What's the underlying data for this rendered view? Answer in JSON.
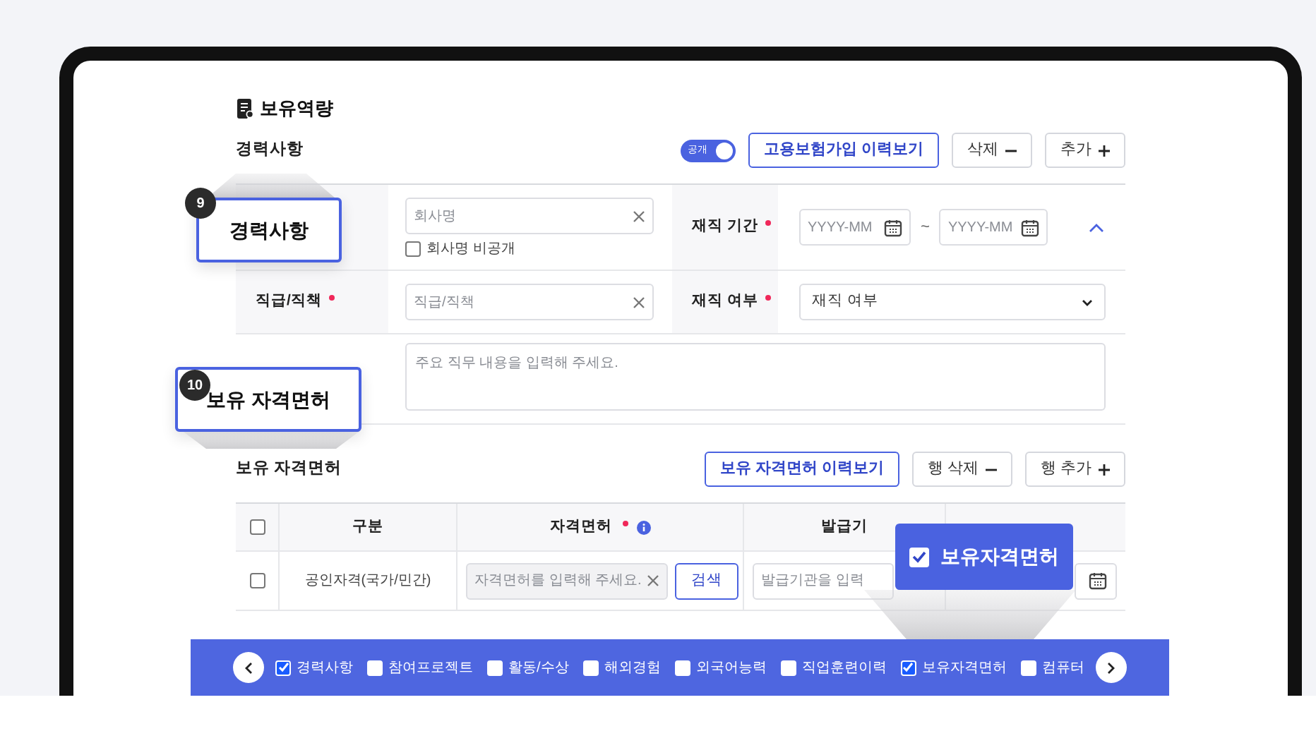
{
  "page_title": "보유역량",
  "career": {
    "title": "경력사항",
    "visibility_toggle": {
      "label": "공개",
      "on": true
    },
    "buttons": [
      {
        "label": "고용보험가입 이력보기",
        "kind": "outline"
      },
      {
        "label": "삭제",
        "kind": "minus"
      },
      {
        "label": "추가",
        "kind": "plus"
      }
    ],
    "company_field": {
      "placeholder": "회사명"
    },
    "hide_company": {
      "label": "회사명 비공개",
      "checked": false
    },
    "period": {
      "label": "재직 기간",
      "required": true,
      "start_placeholder": "YYYY-MM",
      "separator": "~",
      "end_placeholder": "YYYY-MM"
    },
    "expanded": true,
    "position": {
      "label": "직급/직책",
      "required": true,
      "placeholder": "직급/직책"
    },
    "status": {
      "label": "재직 여부",
      "required": true,
      "value": "재직 여부"
    },
    "duties": {
      "placeholder": "주요 직무 내용을 입력해 주세요."
    }
  },
  "licenses": {
    "title": "보유 자격면허",
    "buttons": [
      {
        "label": "보유 자격면허 이력보기",
        "kind": "outline"
      },
      {
        "label": "행 삭제",
        "kind": "minus"
      },
      {
        "label": "행 추가",
        "kind": "plus"
      }
    ],
    "header_checked": false,
    "columns": [
      {
        "label": "구분",
        "required": false,
        "info": false
      },
      {
        "label": "자격면허",
        "required": true,
        "info": true
      },
      {
        "label": "발급기",
        "required": false,
        "info": false
      }
    ],
    "rows": [
      {
        "checked": false,
        "type": "공인자격(국가/민간)",
        "license_placeholder": "자격면허를 입력해 주세요.",
        "search_label": "검색",
        "issuer_placeholder": "발급기관을 입력"
      }
    ]
  },
  "callouts": [
    {
      "number": "9",
      "label": "경력사항"
    },
    {
      "number": "10",
      "label": "보유 자격면허"
    }
  ],
  "highlight_callout": {
    "label": "보유자격면허",
    "checked": true
  },
  "section_nav": {
    "items": [
      {
        "label": "경력사항",
        "checked": true
      },
      {
        "label": "참여프로젝트",
        "checked": false
      },
      {
        "label": "활동/수상",
        "checked": false
      },
      {
        "label": "해외경험",
        "checked": false
      },
      {
        "label": "외국어능력",
        "checked": false
      },
      {
        "label": "직업훈련이력",
        "checked": false
      },
      {
        "label": "보유자격면허",
        "checked": true
      },
      {
        "label": "컴퓨터",
        "checked": false
      }
    ]
  }
}
